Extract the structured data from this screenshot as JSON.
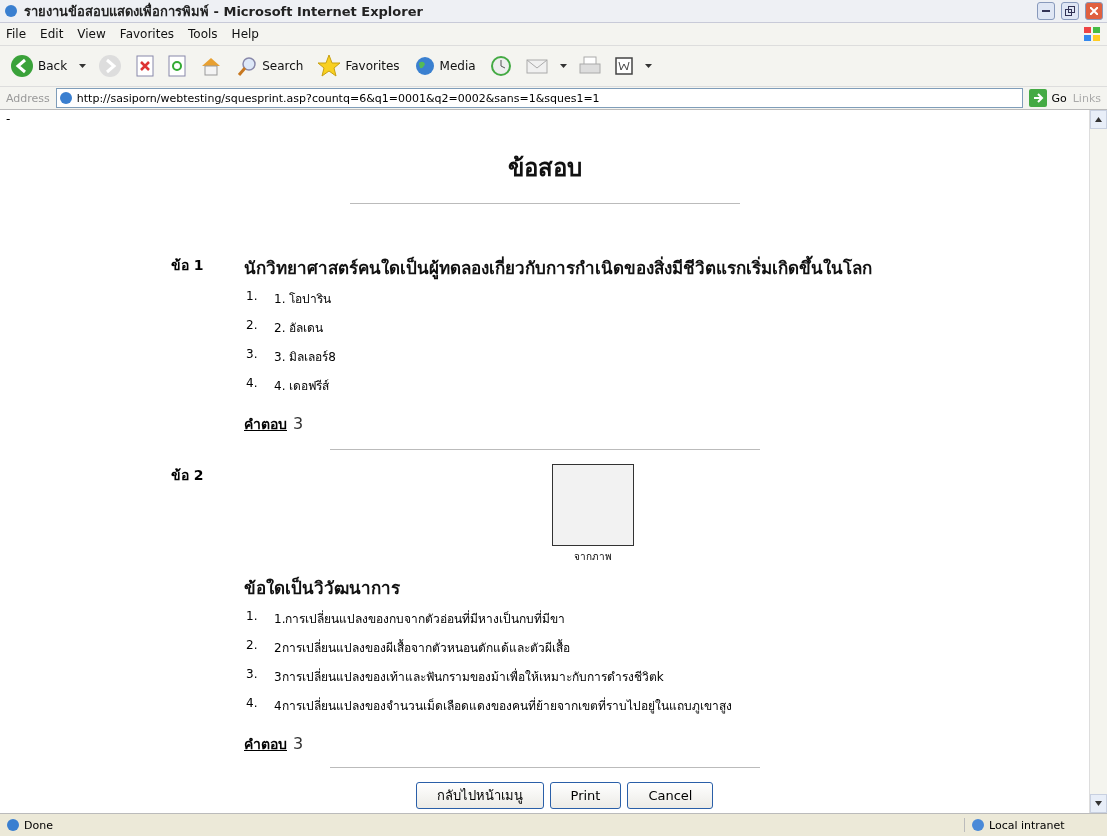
{
  "window": {
    "title": "รายงานข้อสอบแสดงเพื่อการพิมพ์ - Microsoft Internet Explorer"
  },
  "menu": [
    "File",
    "Edit",
    "View",
    "Favorites",
    "Tools",
    "Help"
  ],
  "toolbar": [
    {
      "kind": "back",
      "label": "Back"
    },
    {
      "kind": "forward"
    },
    {
      "kind": "stop"
    },
    {
      "kind": "refresh"
    },
    {
      "kind": "home"
    },
    {
      "kind": "search",
      "label": "Search"
    },
    {
      "kind": "favorites",
      "label": "Favorites"
    },
    {
      "kind": "media",
      "label": "Media"
    },
    {
      "kind": "history"
    },
    {
      "kind": "mail"
    },
    {
      "kind": "print"
    },
    {
      "kind": "edit"
    }
  ],
  "address": {
    "label": "Address",
    "value": "http://sasiporn/webtesting/squesprint.asp?countq=6&q1=0001&q2=0002&sans=1&sques1=1",
    "go": "Go",
    "links": "Links"
  },
  "page": {
    "marker": "-",
    "title": "ข้อสอบ",
    "questions": [
      {
        "label": "ข้อ 1",
        "text": "นักวิทยาศาสตร์คนใดเป็นผู้ทดลองเกี่ยวกับการกำเนิดของสิ่งมีชีวิตแรกเริ่มเกิดขึ้นในโลก",
        "options": [
          {
            "number": "1.",
            "text": "1. โอปาริน"
          },
          {
            "number": "2.",
            "text": "2. อัลเดน"
          },
          {
            "number": "3.",
            "text": "3. มิลเลอร์8"
          },
          {
            "number": "4.",
            "text": "4. เดอฟรีส์"
          }
        ],
        "answer_label": "คำตอบ",
        "answer": "3"
      },
      {
        "label": "ข้อ 2",
        "image": {
          "caption": "จากภาพ"
        },
        "text": "ข้อใดเป็นวิวัฒนาการ",
        "options": [
          {
            "number": "1.",
            "text": "1.การเปลี่ยนแปลงของกบจากตัวอ่อนที่มีหางเป็นกบที่มีขา"
          },
          {
            "number": "2.",
            "text": "2การเปลี่ยนแปลงของผีเสื้อจากตัวหนอนดักแด้และตัวผีเสื้อ"
          },
          {
            "number": "3.",
            "text": "3การเปลี่ยนแปลงของเท้าและฟันกรามของม้าเพื่อให้เหมาะกับการดำรงชีวิตk"
          },
          {
            "number": "4.",
            "text": "4การเปลี่ยนแปลงของจำนวนเม็ดเลือดแดงของคนที่ย้ายจากเขตที่ราบไปอยู่ในแถบภูเขาสูง"
          }
        ],
        "answer_label": "คำตอบ",
        "answer": "3"
      }
    ],
    "buttons": [
      "กลับไปหน้าเมนู",
      "Print",
      "Cancel"
    ]
  },
  "status": {
    "text": "Done",
    "zone": "Local intranet"
  }
}
